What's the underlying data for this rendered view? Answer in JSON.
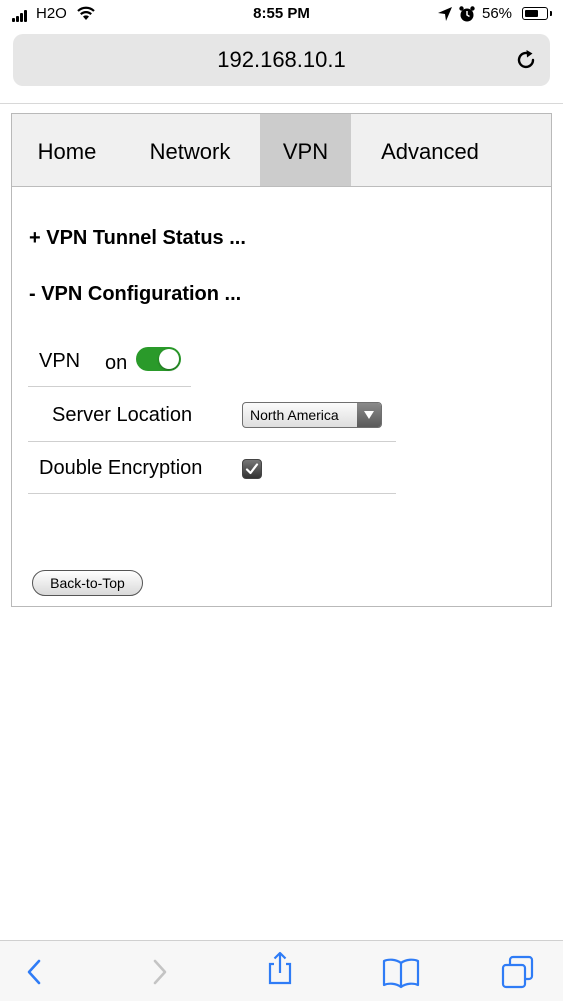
{
  "status_bar": {
    "carrier": "H2O",
    "time": "8:55 PM",
    "battery": "56%"
  },
  "browser": {
    "url": "192.168.10.1"
  },
  "nav": {
    "tabs": [
      {
        "label": "Home"
      },
      {
        "label": "Network"
      },
      {
        "label": "VPN",
        "active": true
      },
      {
        "label": "Advanced"
      }
    ]
  },
  "sections": {
    "tunnel_status": "+ VPN Tunnel Status ...",
    "configuration": "- VPN Configuration ..."
  },
  "config": {
    "vpn_label": "VPN",
    "vpn_state": "on",
    "server_location_label": "Server Location",
    "server_location_value": "North America",
    "double_encryption_label": "Double Encryption",
    "double_encryption_checked": true
  },
  "buttons": {
    "back_to_top": "Back-to-Top"
  },
  "colors": {
    "accent": "#2f7cf6",
    "toggle_on": "#2a9a2a",
    "active_tab": "#cccccc"
  }
}
